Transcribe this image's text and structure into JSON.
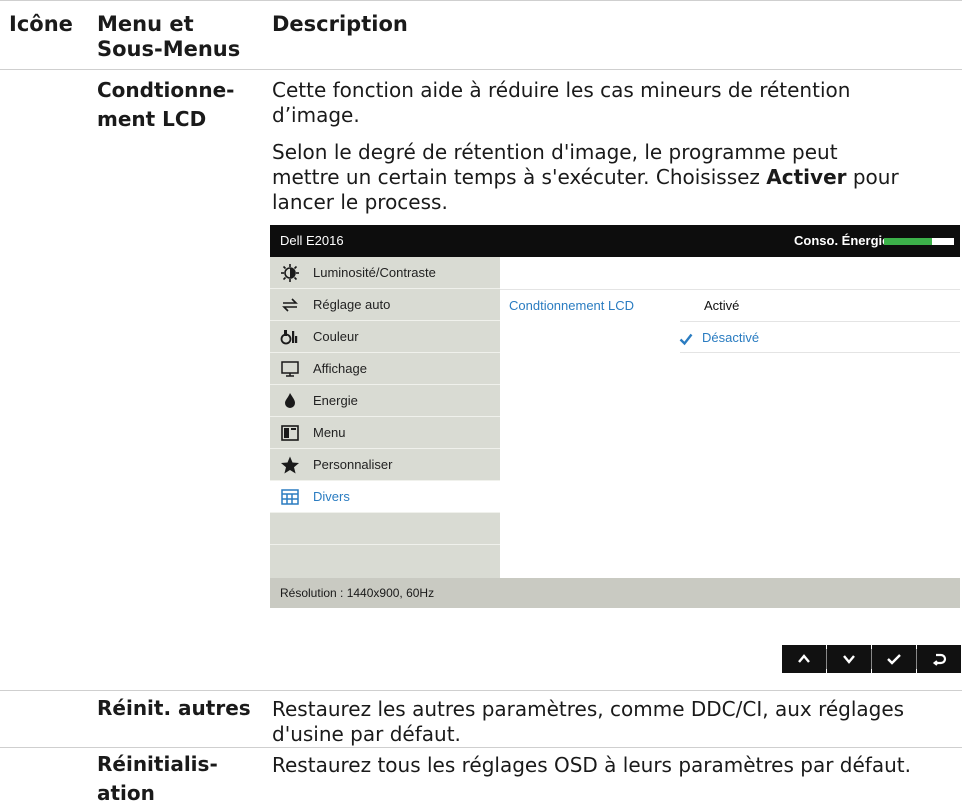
{
  "header": {
    "col_icon": "Icône",
    "col_menu_line1": "Menu et",
    "col_menu_line2": "Sous-Menus",
    "col_description": "Description"
  },
  "rows": [
    {
      "term_line1": "Condtionne-",
      "term_line2": "ment LCD",
      "desc_para1_line1": "Cette fonction aide à réduire les cas mineurs de rétention",
      "desc_para1_line2": "d’image.",
      "desc_para2_line1": "Selon le degré de rétention d'image, le programme peut",
      "desc_para2_line2_prefix": "mettre un certain temps à s'exécuter. Choisissez ",
      "desc_para2_line2_bold": "Activer",
      "desc_para2_line2_suffix": " pour",
      "desc_para2_line3": "lancer le process."
    },
    {
      "term_line1": "Réinit. autres",
      "desc_line1": "Restaurez les autres paramètres, comme DDC/CI, aux réglages",
      "desc_line2": "d'usine par défaut."
    },
    {
      "term_line1": "Réinitialis-",
      "term_line2": "ation",
      "desc_line1": "Restaurez tous les réglages OSD à leurs paramètres par défaut."
    }
  ],
  "osd": {
    "model": "Dell E2016",
    "energy_label": "Conso. Énergie",
    "energy_level": 0.68,
    "menu_items": [
      {
        "label": "Luminosité/Contraste",
        "icon": "brightness-contrast-icon"
      },
      {
        "label": "Réglage auto",
        "icon": "auto-adjust-icon"
      },
      {
        "label": "Couleur",
        "icon": "color-icon"
      },
      {
        "label": "Affichage",
        "icon": "display-icon"
      },
      {
        "label": "Energie",
        "icon": "energy-icon"
      },
      {
        "label": "Menu",
        "icon": "menu-icon"
      },
      {
        "label": "Personnaliser",
        "icon": "star-icon"
      },
      {
        "label": "Divers",
        "icon": "others-icon"
      }
    ],
    "active_item": "Divers",
    "submenu_label": "Condtionnement LCD",
    "option_enabled": "Activé",
    "option_disabled": "Désactivé",
    "selected_option": "Désactivé",
    "resolution": "Résolution : 1440x900, 60Hz",
    "accent_color": "#2a7cc1",
    "energy_bar_color": "#3cb14a"
  },
  "nav_buttons": [
    "up-icon",
    "down-icon",
    "check-icon",
    "back-icon"
  ]
}
